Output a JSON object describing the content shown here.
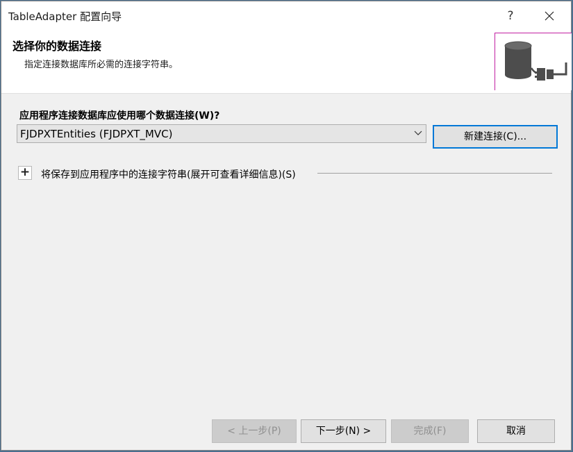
{
  "window": {
    "title": "TableAdapter 配置向导",
    "help_label": "?"
  },
  "header": {
    "title": "选择你的数据连接",
    "subtitle": "指定连接数据库所必需的连接字符串。",
    "image_icon": "database-plug-icon"
  },
  "main": {
    "question_label": "应用程序连接数据库应使用哪个数据连接(W)?",
    "connection_select": {
      "selected": "FJDPXTEntities (FJDPXT_MVC)"
    },
    "new_connection_label": "新建连接(C)...",
    "expander": {
      "symbol": "+",
      "label": "将保存到应用程序中的连接字符串(展开可查看详细信息)(S)"
    }
  },
  "footer": {
    "prev_label": "< 上一步(P)",
    "next_label": "下一步(N) >",
    "finish_label": "完成(F)",
    "cancel_label": "取消"
  },
  "colors": {
    "accent": "#0078d7",
    "image_border": "#c21fa2",
    "icon_gray": "#4d4d4d"
  }
}
